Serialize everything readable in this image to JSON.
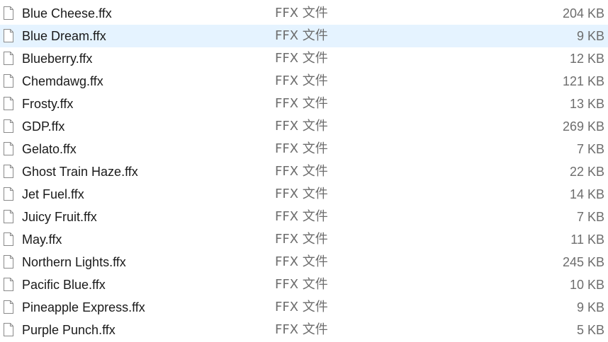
{
  "files": [
    {
      "name": "Blue Cheese.ffx",
      "type": "FFX 文件",
      "size": "204 KB"
    },
    {
      "name": "Blue Dream.ffx",
      "type": "FFX 文件",
      "size": "9 KB",
      "hovered": true
    },
    {
      "name": "Blueberry.ffx",
      "type": "FFX 文件",
      "size": "12 KB"
    },
    {
      "name": "Chemdawg.ffx",
      "type": "FFX 文件",
      "size": "121 KB"
    },
    {
      "name": "Frosty.ffx",
      "type": "FFX 文件",
      "size": "13 KB"
    },
    {
      "name": "GDP.ffx",
      "type": "FFX 文件",
      "size": "269 KB"
    },
    {
      "name": "Gelato.ffx",
      "type": "FFX 文件",
      "size": "7 KB"
    },
    {
      "name": "Ghost Train Haze.ffx",
      "type": "FFX 文件",
      "size": "22 KB"
    },
    {
      "name": "Jet Fuel.ffx",
      "type": "FFX 文件",
      "size": "14 KB"
    },
    {
      "name": "Juicy Fruit.ffx",
      "type": "FFX 文件",
      "size": "7 KB"
    },
    {
      "name": "May.ffx",
      "type": "FFX 文件",
      "size": "11 KB"
    },
    {
      "name": "Northern Lights.ffx",
      "type": "FFX 文件",
      "size": "245 KB"
    },
    {
      "name": "Pacific Blue.ffx",
      "type": "FFX 文件",
      "size": "10 KB"
    },
    {
      "name": "Pineapple Express.ffx",
      "type": "FFX 文件",
      "size": "9 KB"
    },
    {
      "name": "Purple Punch.ffx",
      "type": "FFX 文件",
      "size": "5 KB"
    }
  ],
  "colors": {
    "hover_background": "#e5f3ff",
    "name_text": "#1a1a1a",
    "secondary_text": "#6d6d6d"
  },
  "icons": {
    "file": "file-icon"
  }
}
